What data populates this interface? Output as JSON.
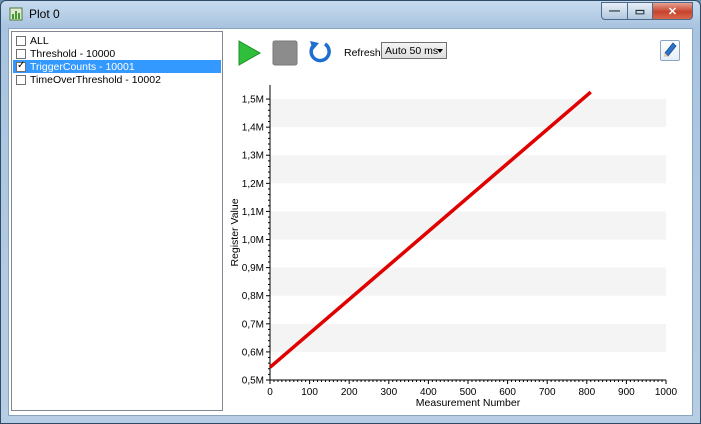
{
  "window": {
    "title": "Plot 0",
    "buttons": {
      "minimize": "—",
      "maximize": "▭",
      "close": "✕"
    }
  },
  "channels": [
    {
      "label": "ALL",
      "checked": false,
      "selected": false
    },
    {
      "label": "Threshold - 10000",
      "checked": false,
      "selected": false
    },
    {
      "label": "TriggerCounts - 10001",
      "checked": true,
      "selected": true
    },
    {
      "label": "TimeOverThreshold - 10002",
      "checked": false,
      "selected": false
    }
  ],
  "toolbar": {
    "play_icon": "play-icon",
    "stop_icon": "stop-icon",
    "reset_icon": "refresh-icon",
    "refresh_label": "Refresh",
    "refresh_value": "Auto 50 ms",
    "edit_icon": "pencil-icon"
  },
  "colors": {
    "line": "#e00000",
    "play": "#2fbf3a",
    "stop": "#8c8c8c",
    "reset": "#1e6fd0",
    "selection": "#3399ff"
  },
  "chart_data": {
    "type": "line",
    "xlabel": "Measurement Number",
    "ylabel": "Register Value",
    "xlim": [
      0,
      1000
    ],
    "ylim": [
      500000,
      1550000
    ],
    "x_ticks": [
      "0",
      "100",
      "200",
      "300",
      "400",
      "500",
      "600",
      "700",
      "800",
      "900",
      "1000"
    ],
    "y_ticks": [
      "0,5M",
      "0,6M",
      "0,7M",
      "0,8M",
      "0,9M",
      "1,0M",
      "1,1M",
      "1,2M",
      "1,3M",
      "1,4M",
      "1,5M"
    ],
    "series": [
      {
        "x": [
          0,
          810
        ],
        "y": [
          545000,
          1525000
        ]
      }
    ]
  }
}
